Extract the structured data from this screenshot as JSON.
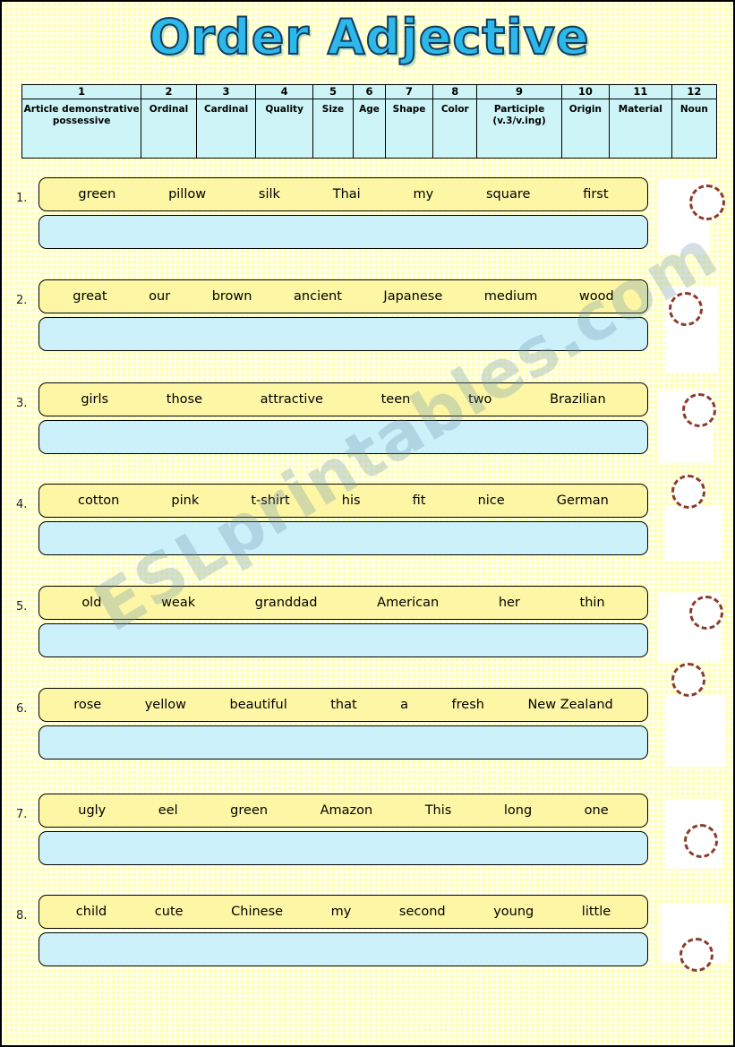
{
  "title": "Order Adjective",
  "colors": {
    "title_fill": "#2cb8e8",
    "title_outline": "#123a5e",
    "page_bg": "#ffffa8",
    "legend_bg": "#cdf4f7",
    "word_box_bg": "#fdf6a5",
    "answer_box_bg": "#cdf1fb",
    "dashed_circle": "#8c3b2a",
    "watermark": "#6e96aa"
  },
  "legend": {
    "numbers": [
      "1",
      "2",
      "3",
      "4",
      "5",
      "6",
      "7",
      "8",
      "9",
      "10",
      "11",
      "12"
    ],
    "labels": [
      "Article demonstrative possessive",
      "Ordinal",
      "Cardinal",
      "Quality",
      "Size",
      "Age",
      "Shape",
      "Color",
      "Participle (v.3/v.ing)",
      "Origin",
      "Material",
      "Noun"
    ]
  },
  "exercises": [
    {
      "number": "1.",
      "words": [
        "green",
        "pillow",
        "silk",
        "Thai",
        "my",
        "square",
        "first"
      ],
      "answer": "",
      "picture": "old-man-granddad-illustration"
    },
    {
      "number": "2.",
      "words": [
        "great",
        "our",
        "brown",
        "ancient",
        "Japanese",
        "medium",
        "wood"
      ],
      "answer": "",
      "picture": "yellow-rose-illustration"
    },
    {
      "number": "3.",
      "words": [
        "girls",
        "those",
        "attractive",
        "teen",
        "two",
        "Brazilian"
      ],
      "answer": "",
      "picture": "green-eel-illustration"
    },
    {
      "number": "4.",
      "words": [
        "cotton",
        "pink",
        "t-shirt",
        "his",
        "fit",
        "nice",
        "German"
      ],
      "answer": "",
      "picture": "green-silk-pillow-illustration"
    },
    {
      "number": "5.",
      "words": [
        "old",
        "weak",
        "granddad",
        "American",
        "her",
        "thin"
      ],
      "answer": "",
      "picture": "sleeping-child-illustration"
    },
    {
      "number": "6.",
      "words": [
        "rose",
        "yellow",
        "beautiful",
        "that",
        "a",
        "fresh",
        "New Zealand"
      ],
      "answer": "",
      "picture": "pink-tshirt-illustration"
    },
    {
      "number": "7.",
      "words": [
        "ugly",
        "eel",
        "green",
        "Amazon",
        "This",
        "long",
        "one"
      ],
      "answer": "",
      "picture": "two-girls-illustration"
    },
    {
      "number": "8.",
      "words": [
        "child",
        "cute",
        "Chinese",
        "my",
        "second",
        "young",
        "little"
      ],
      "answer": "",
      "picture": "wooden-table-illustration"
    }
  ],
  "watermark": "ESLprintables.com"
}
